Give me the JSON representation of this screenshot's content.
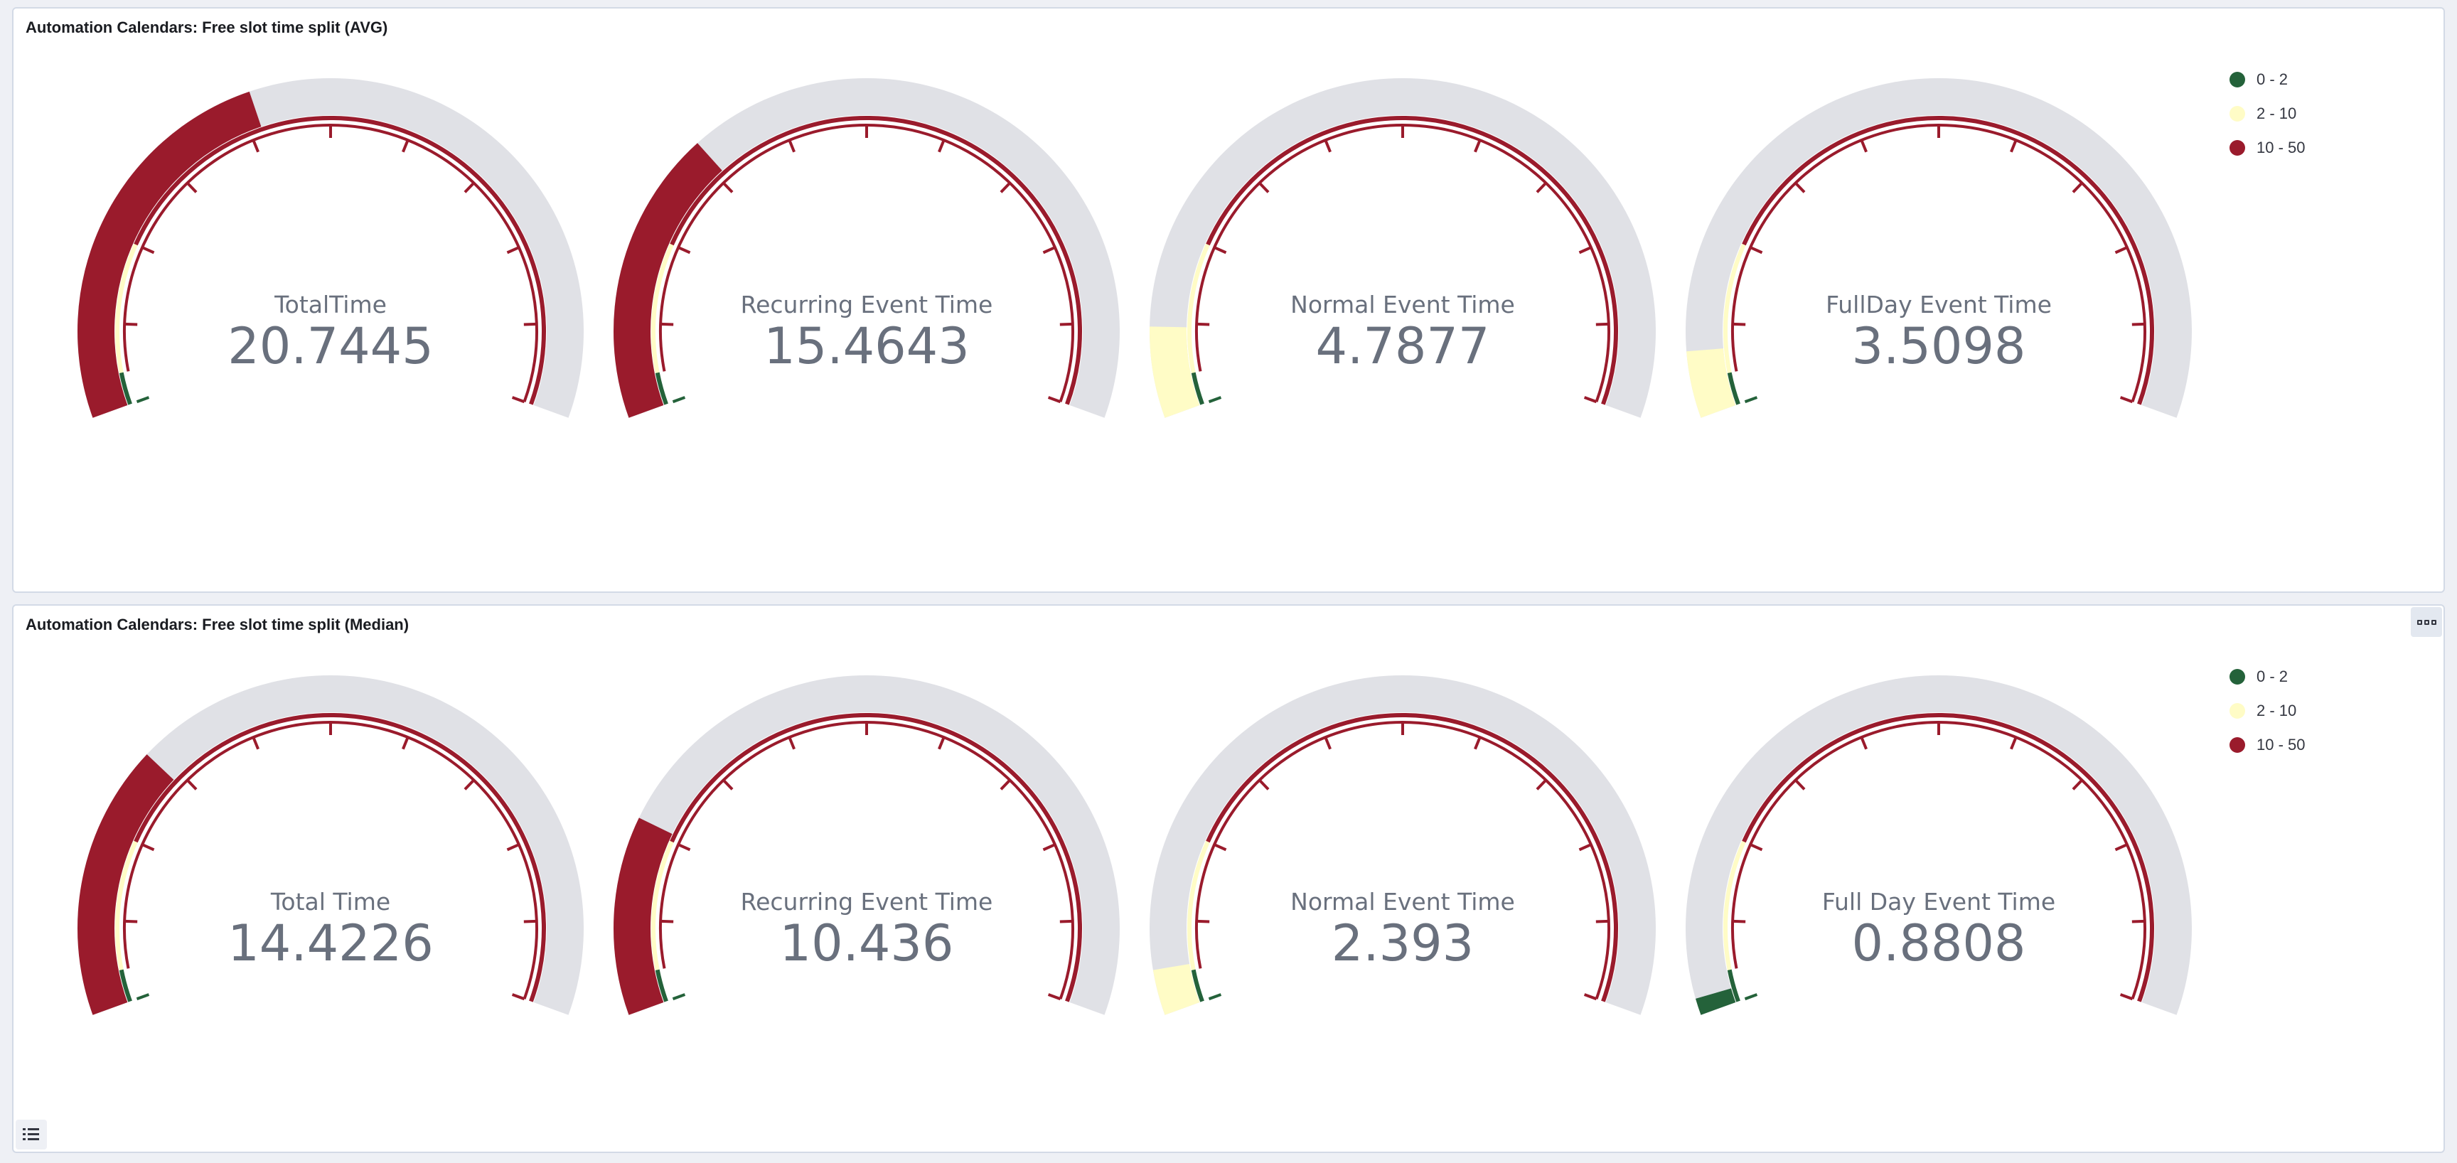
{
  "colors": {
    "green": "#24623a",
    "yellow": "#fffcc6",
    "red": "#9a1b2c",
    "track": "#e0e1e6"
  },
  "panels": [
    {
      "title": "Automation Calendars: Free slot time split (AVG)",
      "legend": [
        {
          "label": "0 - 2",
          "color": "#24623a"
        },
        {
          "label": "2 - 10",
          "color": "#fffcc6"
        },
        {
          "label": "10 - 50",
          "color": "#9a1b2c"
        }
      ]
    },
    {
      "title": "Automation Calendars: Free slot time split (Median)",
      "legend": [
        {
          "label": "0 - 2",
          "color": "#24623a"
        },
        {
          "label": "2 - 10",
          "color": "#fffcc6"
        },
        {
          "label": "10 - 50",
          "color": "#9a1b2c"
        }
      ]
    }
  ],
  "chart_data": [
    {
      "type": "gauge",
      "title": "Automation Calendars: Free slot time split (AVG)",
      "range": [
        0,
        50
      ],
      "ranges": [
        {
          "from": 0,
          "to": 2,
          "label": "0 - 2",
          "color": "#24623a"
        },
        {
          "from": 2,
          "to": 10,
          "label": "2 - 10",
          "color": "#fffcc6"
        },
        {
          "from": 10,
          "to": 50,
          "label": "10 - 50",
          "color": "#9a1b2c"
        }
      ],
      "gauges": [
        {
          "label": "TotalTime",
          "value": 20.7445
        },
        {
          "label": "Recurring Event Time",
          "value": 15.4643
        },
        {
          "label": "Normal Event Time",
          "value": 4.7877
        },
        {
          "label": "FullDay Event Time",
          "value": 3.5098
        }
      ]
    },
    {
      "type": "gauge",
      "title": "Automation Calendars: Free slot time split (Median)",
      "range": [
        0,
        50
      ],
      "ranges": [
        {
          "from": 0,
          "to": 2,
          "label": "0 - 2",
          "color": "#24623a"
        },
        {
          "from": 2,
          "to": 10,
          "label": "2 - 10",
          "color": "#fffcc6"
        },
        {
          "from": 10,
          "to": 50,
          "label": "10 - 50",
          "color": "#9a1b2c"
        }
      ],
      "gauges": [
        {
          "label": "Total Time",
          "value": 14.4226
        },
        {
          "label": "Recurring Event Time",
          "value": 10.436
        },
        {
          "label": "Normal Event Time",
          "value": 2.393
        },
        {
          "label": "Full Day Event Time",
          "value": 0.8808
        }
      ]
    }
  ]
}
